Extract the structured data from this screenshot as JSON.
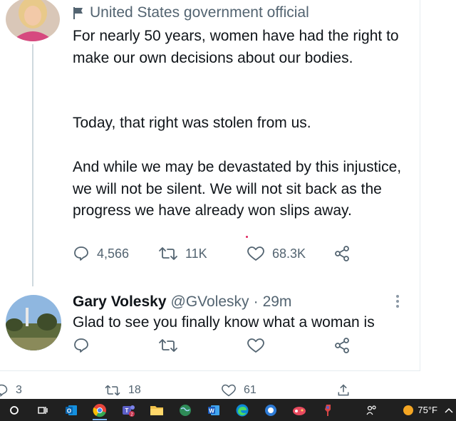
{
  "tweet": {
    "official_label": "United States government official",
    "paragraphs": [
      "For nearly 50 years, women have had the right to make our own decisions about our bodies.",
      "Today, that right was stolen from us.",
      "And while we may be devastated by this injustice, we will not be silent. We will not sit back as the progress we have already won slips away."
    ],
    "replies": "4,566",
    "retweets": "11K",
    "likes": "68.3K"
  },
  "reply": {
    "name": "Gary Volesky",
    "handle": "@GVolesky",
    "separator": "·",
    "time": "29m",
    "text": "Glad to see you finally know what a woman is"
  },
  "bottom_tweet": {
    "replies": "3",
    "retweets": "18",
    "likes": "61"
  },
  "taskbar": {
    "temperature": "75°F",
    "teams_badge": "2"
  },
  "colors": {
    "text": "#0f1419",
    "secondary": "#536471",
    "thread_line": "#cfd9de",
    "taskbar": "#202020"
  }
}
